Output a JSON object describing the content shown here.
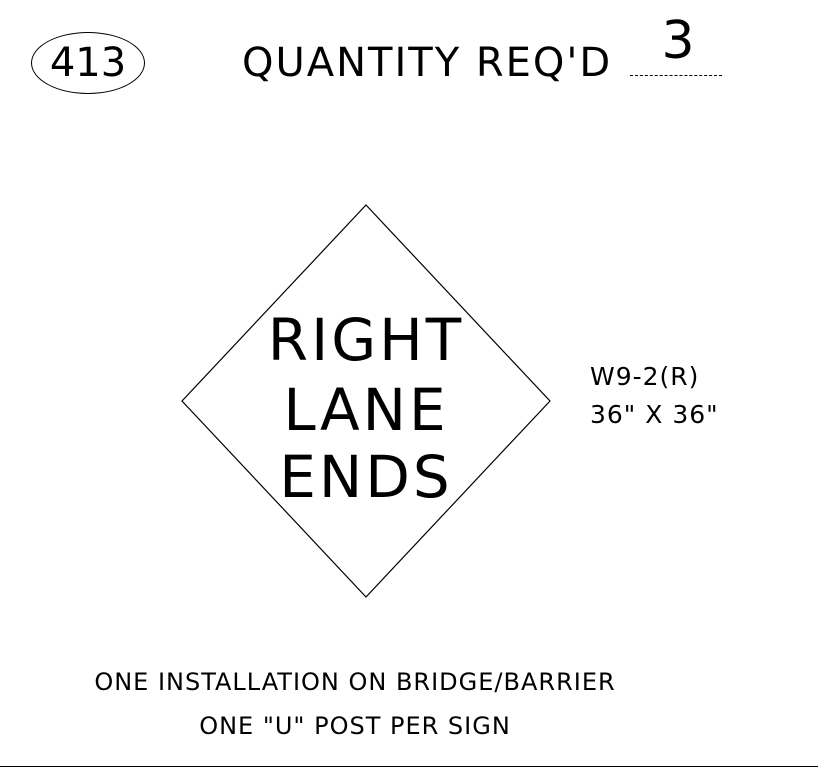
{
  "sign_number": "413",
  "quantity": {
    "label": "QUANTITY REQ'D",
    "value": "3"
  },
  "sign": {
    "shape": "diamond",
    "lines": [
      "RIGHT",
      "LANE",
      "ENDS"
    ]
  },
  "sign_code": {
    "code": "W9-2(R)",
    "size": "36\" X 36\""
  },
  "notes": [
    "ONE INSTALLATION ON BRIDGE/BARRIER",
    "ONE \"U\" POST PER SIGN"
  ],
  "colors": {
    "ink": "#000000",
    "paper": "#ffffff"
  }
}
